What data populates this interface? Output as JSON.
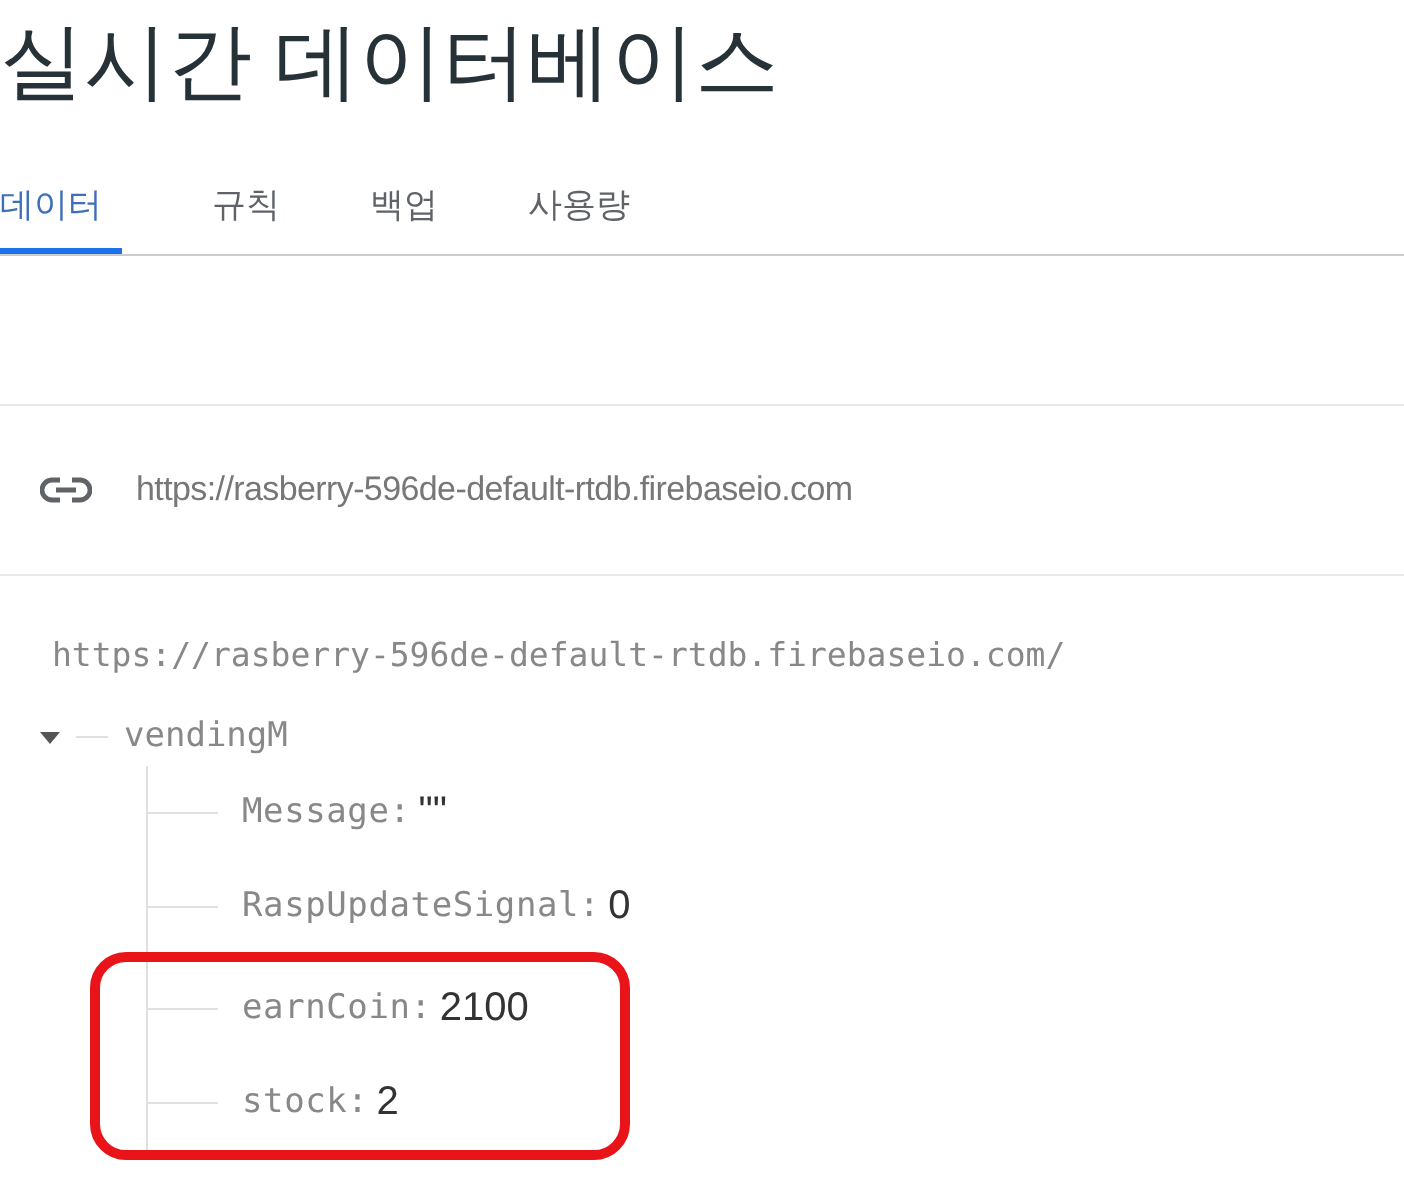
{
  "title": "실시간 데이터베이스",
  "tabs": [
    {
      "label": "데이터",
      "selected": true
    },
    {
      "label": "규칙",
      "selected": false
    },
    {
      "label": "백업",
      "selected": false
    },
    {
      "label": "사용량",
      "selected": false
    }
  ],
  "database_url": "https://rasberry-596de-default-rtdb.firebaseio.com",
  "tree": {
    "root": "https://rasberry-596de-default-rtdb.firebaseio.com/",
    "node": {
      "key": "vendingM",
      "expanded": true,
      "children": [
        {
          "key": "Message:",
          "value": "\"\"",
          "highlighted": false
        },
        {
          "key": "RaspUpdateSignal:",
          "value": "0",
          "highlighted": false
        },
        {
          "key": "earnCoin:",
          "value": "2100",
          "highlighted": true
        },
        {
          "key": "stock:",
          "value": "2",
          "highlighted": true
        }
      ]
    }
  }
}
